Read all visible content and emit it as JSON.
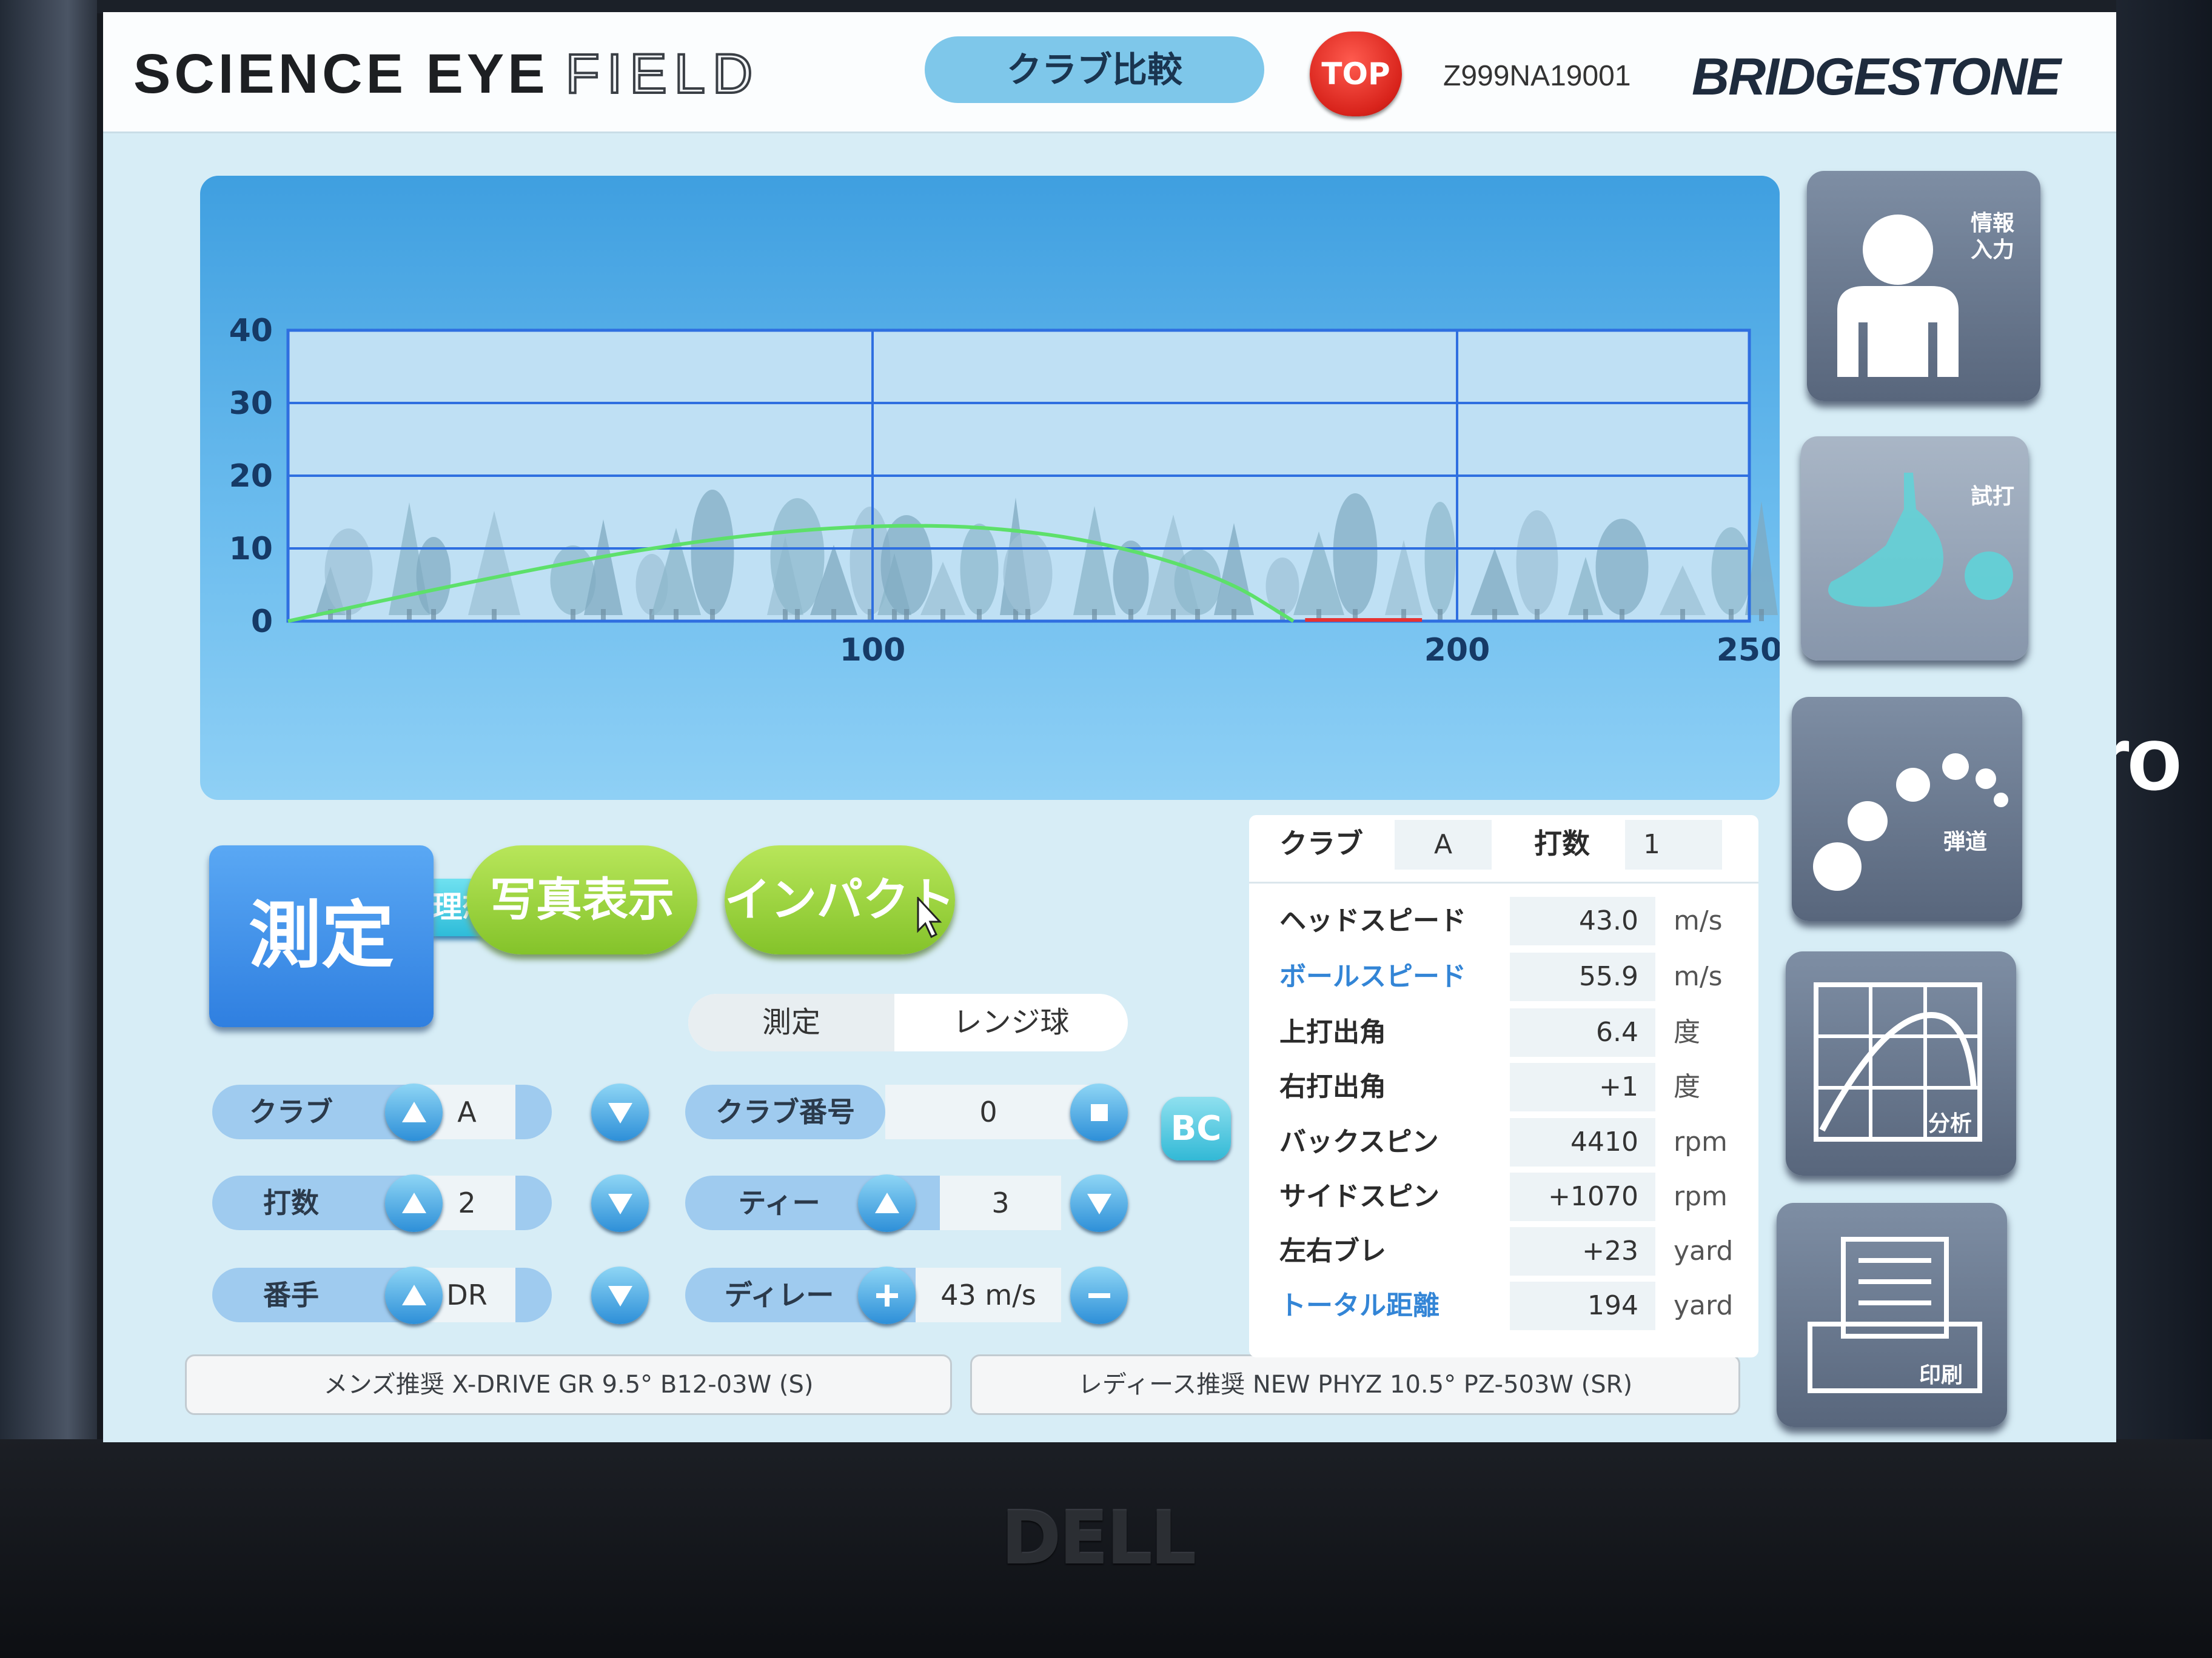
{
  "header": {
    "app_title_main": "SCIENCE EYE",
    "app_title_field": "FIELD",
    "mode": "クラブ比較",
    "top_button": "TOP",
    "serial": "Z999NA19001",
    "brand": "BRIDGESTONE"
  },
  "chart_data": {
    "type": "line",
    "x_ticks": [
      "100",
      "200",
      "250"
    ],
    "x_unit": "yard",
    "y_ticks": [
      "40",
      "30",
      "20",
      "10",
      "0"
    ],
    "xlim": [
      0,
      250
    ],
    "ylim": [
      0,
      40
    ],
    "series": [
      {
        "color": "#5de06a",
        "x": [
          0,
          20,
          40,
          60,
          80,
          100,
          120,
          140,
          160,
          172
        ],
        "y": [
          0,
          3.5,
          6.8,
          9.8,
          12.0,
          13.2,
          13.0,
          10.8,
          6.0,
          0
        ]
      }
    ],
    "rollout": {
      "color": "#e63232",
      "x_start": 174,
      "x_end": 194
    },
    "grid": true
  },
  "ideal_button": "理想",
  "controls": {
    "measure_button": "測定",
    "photo_button": "写真表示",
    "impact_button": "インパクト",
    "mode_left": "測定",
    "mode_right": "レンジ球",
    "club_label": "クラブ",
    "club_value": "A",
    "club_number_label": "クラブ番号",
    "club_number_value": "0",
    "bc_button": "BC",
    "shots_label": "打数",
    "shots_value": "2",
    "tee_label": "ティー",
    "tee_value": "3",
    "number_label": "番手",
    "number_value": "DR",
    "delay_label": "ディレー",
    "delay_value": "43 m/s",
    "mens_recommend": "メンズ推奨 X-DRIVE GR 9.5° B12-03W (S)",
    "ladies_recommend": "レディース推奨 NEW PHYZ 10.5° PZ-503W (SR)"
  },
  "data_table": {
    "club_label": "クラブ",
    "club_value": "A",
    "shots_label": "打数",
    "shots_value": "1",
    "rows": [
      {
        "label": "ヘッドスピード",
        "value": "43.0",
        "unit": "m/s"
      },
      {
        "label": "ボールスピード",
        "value": "55.9",
        "unit": "m/s"
      },
      {
        "label": "上打出角",
        "value": "6.4",
        "unit": "度"
      },
      {
        "label": "右打出角",
        "value": "+1",
        "unit": "度"
      },
      {
        "label": "バックスピン",
        "value": "4410",
        "unit": "rpm"
      },
      {
        "label": "サイドスピン",
        "value": "+1070",
        "unit": "rpm"
      },
      {
        "label": "左右ブレ",
        "value": "+23",
        "unit": "yard"
      },
      {
        "label": "トータル距離",
        "value": "194",
        "unit": "yard"
      }
    ]
  },
  "side_buttons": {
    "info": "情報入力",
    "info_line1": "情報",
    "info_line2": "入力",
    "trial": "試打",
    "trajectory": "弾道",
    "analysis": "分析",
    "print": "印刷"
  },
  "background": {
    "monitor_logo": "DELL",
    "sign_fragment": "ro"
  }
}
